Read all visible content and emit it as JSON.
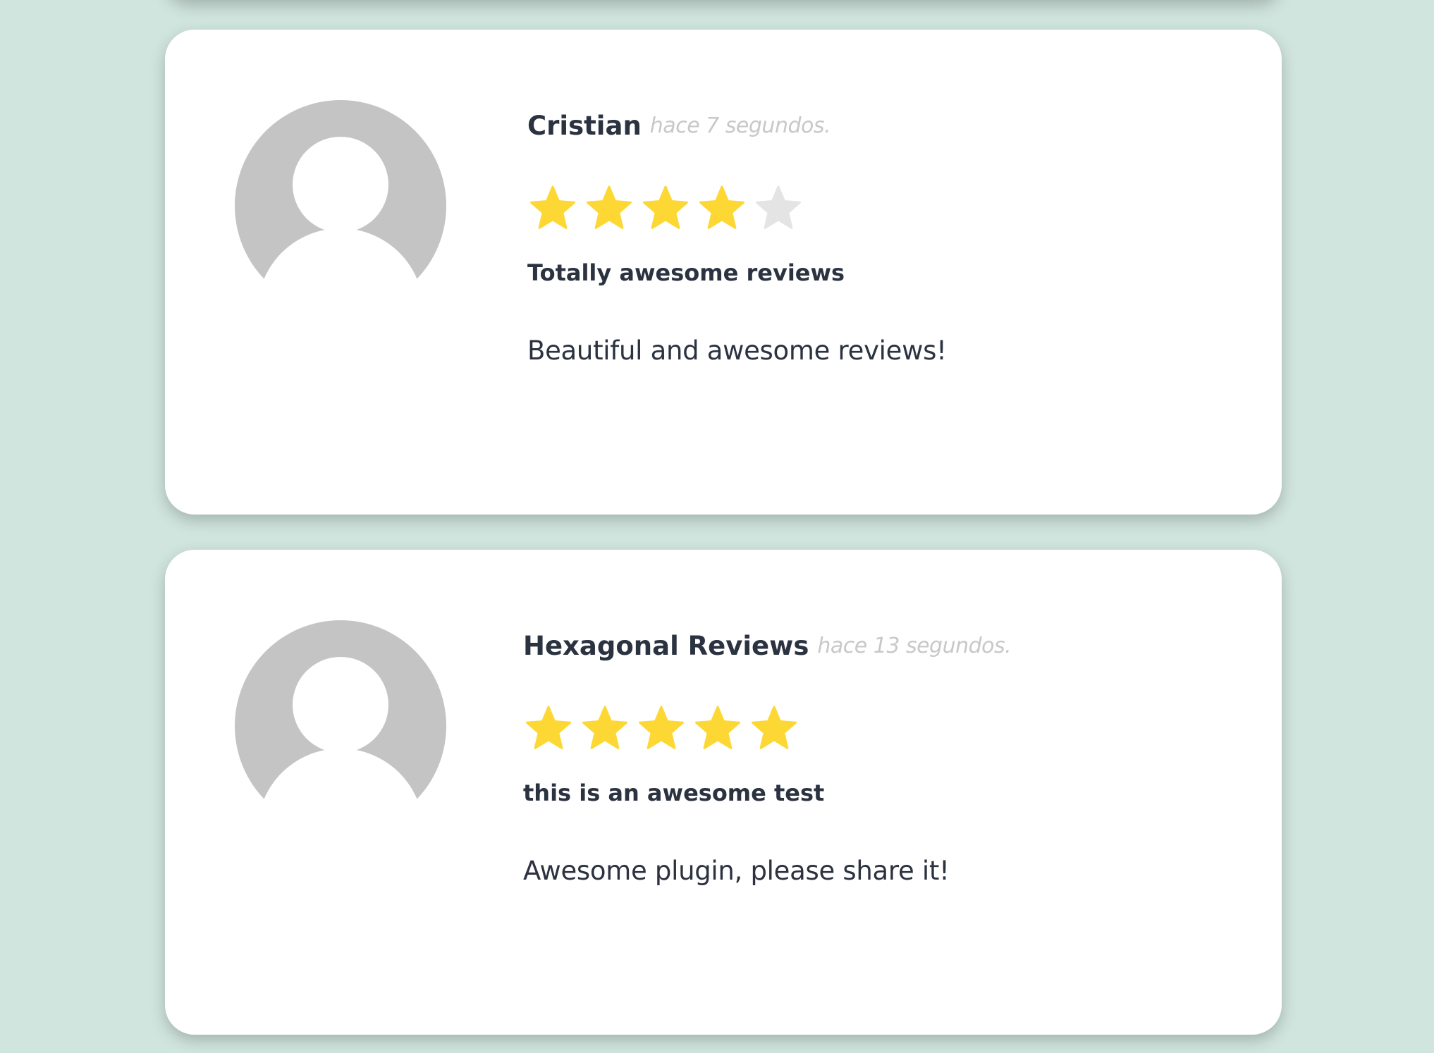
{
  "colors": {
    "page_background": "#d1e5df",
    "card_background": "#ffffff",
    "star_filled": "#fdd835",
    "star_empty": "#e4e4e4",
    "avatar": "#c4c4c4",
    "text": "#2b3240",
    "timestamp": "#c8c8c8"
  },
  "reviews": [
    {
      "avatar_icon": "default-user-avatar-icon",
      "name": "Cristian",
      "time": "hace 7 segundos.",
      "rating": 4,
      "max_rating": 5,
      "title": "Totally awesome reviews",
      "body": "Beautiful and awesome reviews!"
    },
    {
      "avatar_icon": "default-user-avatar-icon",
      "name": "Hexagonal Reviews",
      "time": "hace 13 segundos.",
      "rating": 5,
      "max_rating": 5,
      "title": "this is an awesome test",
      "body": "Awesome plugin, please share it!"
    }
  ]
}
